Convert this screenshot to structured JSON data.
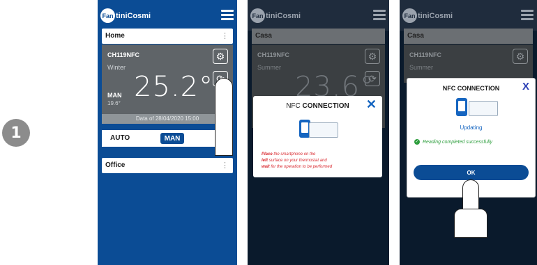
{
  "step_number": "1",
  "brand": {
    "badge": "Fan",
    "name": "tiniCosmi"
  },
  "screen1": {
    "section_home": "Home",
    "thermostat_name": "CH119NFC",
    "season": "Winter",
    "temperature": "25.2°",
    "mode_label": "MAN",
    "setpoint": "19.6°",
    "date_text": "Data of 28/04/2020 15:00",
    "auto_label": "AUTO",
    "man_label": "MAN",
    "section_office": "Office"
  },
  "screen2": {
    "section": "Casa",
    "thermostat_name": "CH119NFC",
    "season": "Summer",
    "temperature": "23.6°",
    "dialog_title_plain": "NFC ",
    "dialog_title_bold": "CONNECTION",
    "close": "✕",
    "instr_place": "Place",
    "instr_1": " the smartphone on the",
    "instr_left": "left",
    "instr_2": " surface on your thermostat and",
    "instr_wait": "wait",
    "instr_3": " for the operation to be performed"
  },
  "screen3": {
    "section": "Casa",
    "thermostat_name": "CH119NFC",
    "season": "Summer",
    "dialog_title": "NFC CONNECTION",
    "close": "X",
    "status": "Updating",
    "success": "Reading completed successfully",
    "ok": "OK"
  },
  "colors": {
    "brand_blue": "#0b4c95",
    "accent_blue": "#1565c0",
    "success_green": "#2e9e3e",
    "warning_red": "#d9282e"
  }
}
